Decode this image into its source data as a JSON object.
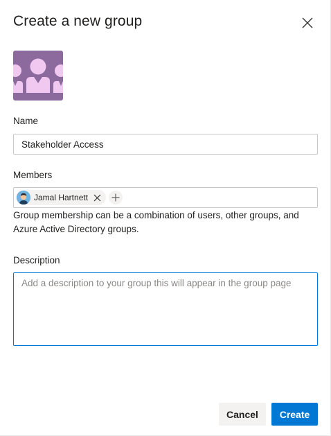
{
  "dialog": {
    "title": "Create a new group"
  },
  "name_field": {
    "label": "Name",
    "value": "Stakeholder Access"
  },
  "members_field": {
    "label": "Members",
    "members": [
      {
        "name": "Jamal Hartnett"
      }
    ],
    "helper_text": "Group membership can be a combination of users, other groups, and Azure Active Directory groups."
  },
  "description_field": {
    "label": "Description",
    "value": "",
    "placeholder": "Add a description to your group this will appear in the group page"
  },
  "buttons": {
    "cancel": "Cancel",
    "create": "Create"
  },
  "colors": {
    "group_avatar_bg": "#8c6a9e",
    "group_avatar_fg": "#f0c8f0",
    "primary": "#0078d4",
    "secondary_bg": "#f3f2f1"
  },
  "icons": {
    "close": "close-icon",
    "group_avatar": "group-icon",
    "remove_member": "remove-icon",
    "add_member": "plus-icon"
  }
}
